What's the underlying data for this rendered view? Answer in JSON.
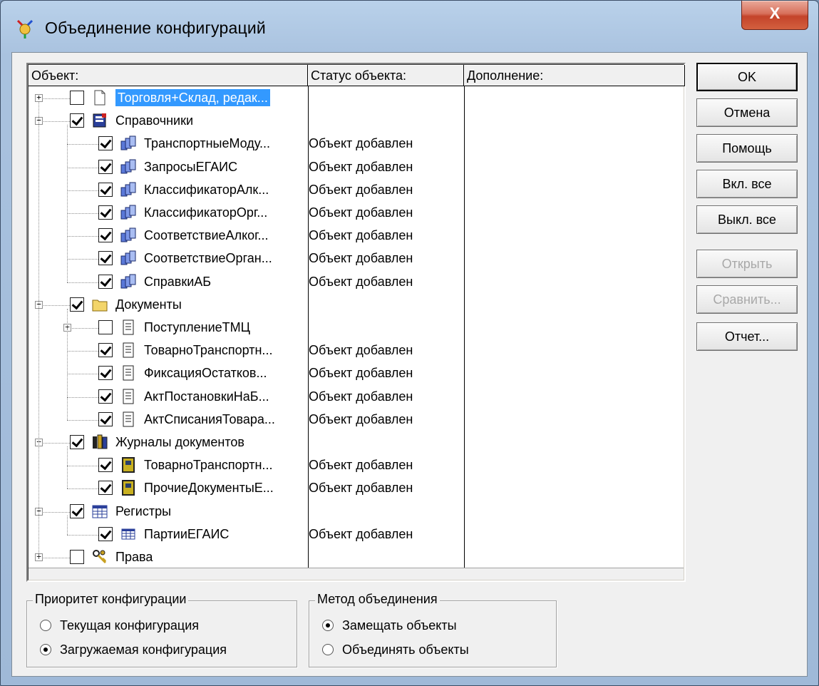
{
  "window": {
    "title": "Объединение конфигураций",
    "close_glyph": "X"
  },
  "columns": {
    "object": "Объект:",
    "status": "Статус объекта:",
    "addition": "Дополнение:"
  },
  "tree": [
    {
      "label": "Торговля+Склад, редак...",
      "status": "",
      "level": 0,
      "expander": "+",
      "checked": false,
      "icon": "document-page-icon",
      "selected": true
    },
    {
      "label": "Справочники",
      "status": "",
      "level": 0,
      "expander": "−",
      "checked": true,
      "icon": "catalog-icon"
    },
    {
      "label": "ТранспортныеМоду...",
      "status": "Объект добавлен",
      "level": 1,
      "checked": true,
      "icon": "catalog-item-icon"
    },
    {
      "label": "ЗапросыЕГАИС",
      "status": "Объект добавлен",
      "level": 1,
      "checked": true,
      "icon": "catalog-item-icon"
    },
    {
      "label": "КлассификаторАлк...",
      "status": "Объект добавлен",
      "level": 1,
      "checked": true,
      "icon": "catalog-item-icon"
    },
    {
      "label": "КлассификаторОрг...",
      "status": "Объект добавлен",
      "level": 1,
      "checked": true,
      "icon": "catalog-item-icon"
    },
    {
      "label": "СоответствиеАлког...",
      "status": "Объект добавлен",
      "level": 1,
      "checked": true,
      "icon": "catalog-item-icon"
    },
    {
      "label": "СоответствиеОрган...",
      "status": "Объект добавлен",
      "level": 1,
      "checked": true,
      "icon": "catalog-item-icon"
    },
    {
      "label": "СправкиАБ",
      "status": "Объект добавлен",
      "level": 1,
      "checked": true,
      "icon": "catalog-item-icon"
    },
    {
      "label": "Документы",
      "status": "",
      "level": 0,
      "expander": "−",
      "checked": true,
      "icon": "folder-icon"
    },
    {
      "label": "ПоступлениеТМЦ",
      "status": "",
      "level": 1,
      "expander": "+",
      "checked": false,
      "icon": "document-icon"
    },
    {
      "label": "ТоварноТранспортн...",
      "status": "Объект добавлен",
      "level": 1,
      "checked": true,
      "icon": "document-icon"
    },
    {
      "label": "ФиксацияОстатков...",
      "status": "Объект добавлен",
      "level": 1,
      "checked": true,
      "icon": "document-icon"
    },
    {
      "label": "АктПостановкиНаБ...",
      "status": "Объект добавлен",
      "level": 1,
      "checked": true,
      "icon": "document-icon"
    },
    {
      "label": "АктСписанияТовара...",
      "status": "Объект добавлен",
      "level": 1,
      "checked": true,
      "icon": "document-icon"
    },
    {
      "label": "Журналы документов",
      "status": "",
      "level": 0,
      "expander": "−",
      "checked": true,
      "icon": "journals-icon"
    },
    {
      "label": "ТоварноТранспортн...",
      "status": "Объект добавлен",
      "level": 1,
      "checked": true,
      "icon": "journal-icon"
    },
    {
      "label": "ПрочиеДокументыЕ...",
      "status": "Объект добавлен",
      "level": 1,
      "checked": true,
      "icon": "journal-icon"
    },
    {
      "label": "Регистры",
      "status": "",
      "level": 0,
      "expander": "−",
      "checked": true,
      "icon": "registers-icon"
    },
    {
      "label": "ПартииЕГАИС",
      "status": "Объект добавлен",
      "level": 1,
      "checked": true,
      "icon": "register-icon"
    },
    {
      "label": "Права",
      "status": "",
      "level": 0,
      "expander": "+",
      "checked": false,
      "icon": "keys-icon"
    }
  ],
  "buttons": {
    "ok": "OK",
    "cancel": "Отмена",
    "help": "Помощь",
    "check_all": "Вкл. все",
    "uncheck_all": "Выкл. все",
    "open": "Открыть",
    "compare": "Сравнить...",
    "report": "Отчет..."
  },
  "priority_group": {
    "title": "Приоритет конфигурации",
    "options": [
      "Текущая конфигурация",
      "Загружаемая конфигурация"
    ],
    "selected": 1
  },
  "method_group": {
    "title": "Метод объединения",
    "options": [
      "Замещать объекты",
      "Объединять объекты"
    ],
    "selected": 0
  }
}
